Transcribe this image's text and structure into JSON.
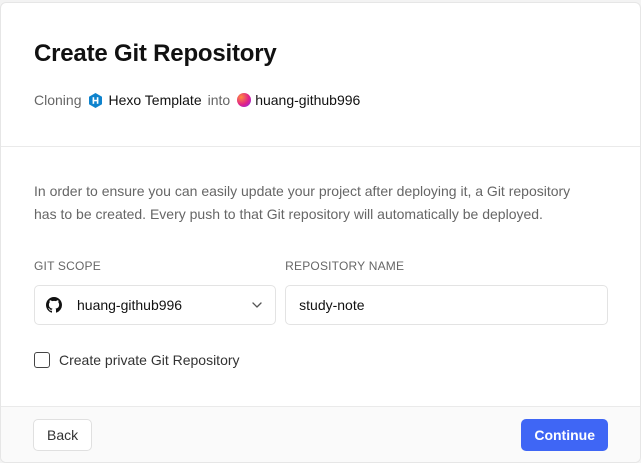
{
  "dialog": {
    "title": "Create Git Repository",
    "cloning_prefix": "Cloning",
    "template_name": "Hexo Template",
    "into_word": "into",
    "team_name": "huang-github996"
  },
  "body": {
    "description": "In order to ensure you can easily update your project after deploying it, a Git repository has to be created. Every push to that Git repository will automatically be deployed.",
    "git_scope": {
      "label": "GIT SCOPE",
      "value": "huang-github996",
      "icon": "github-icon"
    },
    "repository_name": {
      "label": "REPOSITORY NAME",
      "value": "study-note"
    },
    "private_checkbox": {
      "label": "Create private Git Repository",
      "checked": false
    }
  },
  "footer": {
    "back_label": "Back",
    "continue_label": "Continue"
  },
  "colors": {
    "primary_button": "#3f66f5",
    "hexo_icon": "#0e83cd"
  }
}
